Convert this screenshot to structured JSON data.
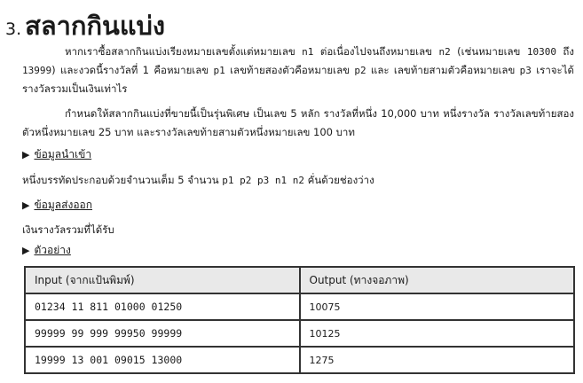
{
  "title": {
    "number": "3.",
    "text": "สลากกินแบ่ง"
  },
  "para1": {
    "t1": "หากเราซื้อสลากกินแบ่งเรียงหมายเลขตั้งแต่หมายเลข ",
    "n1": "n1",
    "t2": " ต่อเนื่องไปจนถึงหมายเลข ",
    "n2": "n2",
    "t3": " (เช่นหมายเลข ",
    "ex1": "10300",
    "t4": " ถึง ",
    "ex2": "13999",
    "t5": ") และงวดนี้รางวัลที่ 1 คือหมายเลข ",
    "p1": "p1",
    "t6": " เลขท้ายสองตัวคือหมายเลข ",
    "p2": "p2",
    "t7": " และ เลขท้ายสามตัวคือหมายเลข ",
    "p3": "p3",
    "t8": " เราจะได้รางวัลรวมเป็นเงินเท่าไร"
  },
  "para2": "กำหนดให้สลากกินแบ่งที่ขายนี้เป็นรุ่นพิเศษ เป็นเลข 5 หลัก รางวัลที่หนึ่ง 10,000 บาท หนึ่งรางวัล รางวัลเลขท้ายสองตัวหนึ่งหมายเลข 25 บาท และรางวัลเลขท้ายสามตัวหนึ่งหมายเลข 100 บาท",
  "input_section": {
    "label": "ข้อมูลนำเข้า",
    "t1": "หนึ่งบรรทัดประกอบด้วยจำนวนเต็ม 5 จำนวน ",
    "vars": "p1 p2 p3 n1 n2",
    "t2": " คั่นด้วยช่องว่าง"
  },
  "output_section": {
    "label": "ข้อมูลส่งออก",
    "text": "เงินรางวัลรวมที่ได้รับ"
  },
  "example_section": {
    "label": "ตัวอย่าง"
  },
  "table": {
    "headers": [
      "Input (จากแป้นพิมพ์)",
      "Output (ทางจอภาพ)"
    ],
    "rows": [
      [
        "01234 11 811 01000 01250",
        "10075"
      ],
      [
        "99999 99 999 99950 99999",
        "10125"
      ],
      [
        "19999 13 001 09015 13000",
        "1275"
      ]
    ]
  }
}
